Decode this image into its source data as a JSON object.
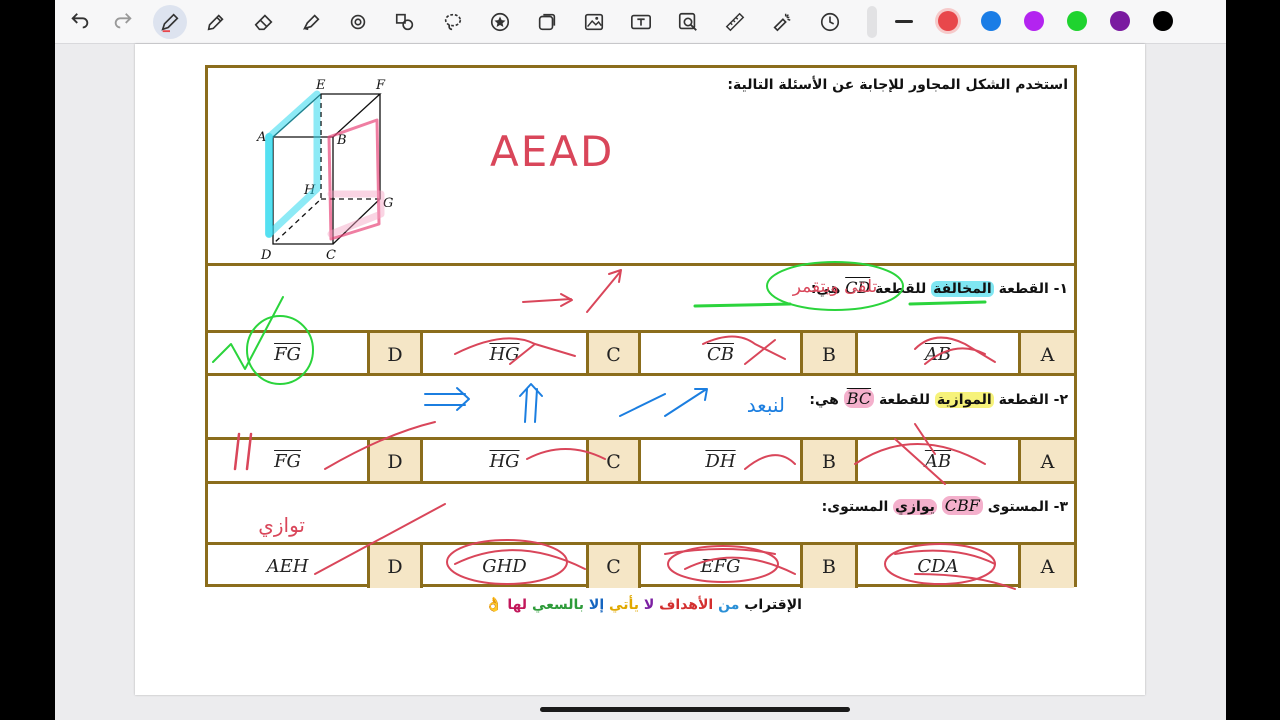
{
  "toolbar": {
    "tools": [
      "undo-icon",
      "redo-icon",
      "pen-icon",
      "pencil-icon",
      "eraser-icon",
      "highlighter-icon",
      "shape-icon",
      "shapes-icon",
      "lasso-icon",
      "sticker-icon",
      "image-crop-icon",
      "image-icon",
      "text-box-icon",
      "image-search-icon",
      "ruler-icon",
      "laser-pointer-icon",
      "timer-icon"
    ],
    "colors": [
      "#2b2b2b",
      "#e8474b",
      "#1a7de6",
      "#b324f0",
      "#1fd32f",
      "#7a1aa0",
      "#000000"
    ],
    "selected_color": "#e8474b"
  },
  "worksheet": {
    "header": "استخدم الشكل المجاور للإجابة عن الأسئلة التالية:",
    "cube_labels": {
      "E": "E",
      "F": "F",
      "A": "A",
      "B": "B",
      "H": "H",
      "G": "G",
      "D": "D",
      "C": "C"
    },
    "questions": [
      {
        "num": "١-",
        "before": "القطعة",
        "highlight": "المخالفة",
        "after": "للقطعة",
        "segment": "CD",
        "suffix": "هي:",
        "options": [
          {
            "letter": "A",
            "value": "AB",
            "overline": true
          },
          {
            "letter": "B",
            "value": "CB",
            "overline": true
          },
          {
            "letter": "C",
            "value": "HG",
            "overline": true
          },
          {
            "letter": "D",
            "value": "FG",
            "overline": true
          }
        ]
      },
      {
        "num": "٢-",
        "before": "القطعة",
        "highlight": "الموازية",
        "after": "للقطعة",
        "segment": "BC",
        "suffix": "هي:",
        "options": [
          {
            "letter": "A",
            "value": "AB",
            "overline": true
          },
          {
            "letter": "B",
            "value": "DH",
            "overline": true
          },
          {
            "letter": "C",
            "value": "HG",
            "overline": true
          },
          {
            "letter": "D",
            "value": "FG",
            "overline": true
          }
        ]
      },
      {
        "num": "٣-",
        "before": "المستوى",
        "segment": "CBF",
        "highlight": "يوازي",
        "after": "المستوى:",
        "options": [
          {
            "letter": "A",
            "value": "CDA",
            "overline": false
          },
          {
            "letter": "B",
            "value": "EFG",
            "overline": false
          },
          {
            "letter": "C",
            "value": "GHD",
            "overline": false
          },
          {
            "letter": "D",
            "value": "AEH",
            "overline": false
          }
        ]
      }
    ],
    "motto": [
      {
        "t": "الإقتراب ",
        "c": "#111111"
      },
      {
        "t": "من ",
        "c": "#2a8fd6"
      },
      {
        "t": "الأهداف ",
        "c": "#d32f2f"
      },
      {
        "t": "لا ",
        "c": "#7b1fa2"
      },
      {
        "t": "يأتي ",
        "c": "#e0a800"
      },
      {
        "t": "إلا ",
        "c": "#1565c0"
      },
      {
        "t": "بالسعي ",
        "c": "#2e9b3a"
      },
      {
        "t": "لها",
        "c": "#c2185b"
      }
    ],
    "motto_emoji": "👌"
  },
  "handwriting": {
    "aead": "AEAD",
    "q1_note": "تلقى ويتقمر",
    "q2_note": "لنبعد",
    "q3_note": "توازي"
  }
}
